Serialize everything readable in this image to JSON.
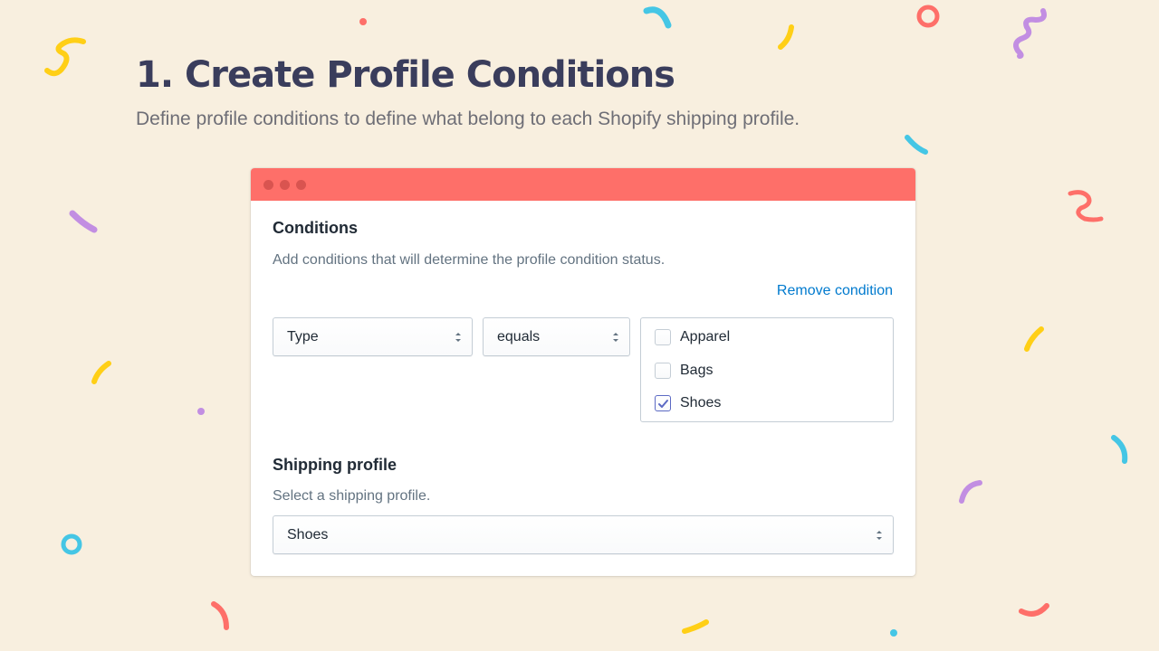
{
  "hero": {
    "title": "1. Create Profile Conditions",
    "subtitle": "Define profile conditions to define what belong to each Shopify shipping profile."
  },
  "window": {
    "titlebar_color": "#fe6f69"
  },
  "conditions": {
    "heading": "Conditions",
    "description": "Add conditions that will determine the profile condition status.",
    "remove_link": "Remove condition",
    "field_select": {
      "value": "Type"
    },
    "operator_select": {
      "value": "equals"
    },
    "options": [
      {
        "label": "Apparel",
        "checked": false
      },
      {
        "label": "Bags",
        "checked": false
      },
      {
        "label": "Shoes",
        "checked": true
      }
    ]
  },
  "shipping": {
    "heading": "Shipping profile",
    "description": "Select a shipping profile.",
    "profile_select": {
      "value": "Shoes"
    }
  },
  "colors": {
    "background": "#f8efdf",
    "accent_link": "#007ace",
    "checkbox_accent": "#5c6ac4",
    "confetti": [
      "#ffcf16",
      "#fe6f69",
      "#45c6e5",
      "#c28ee2"
    ]
  }
}
